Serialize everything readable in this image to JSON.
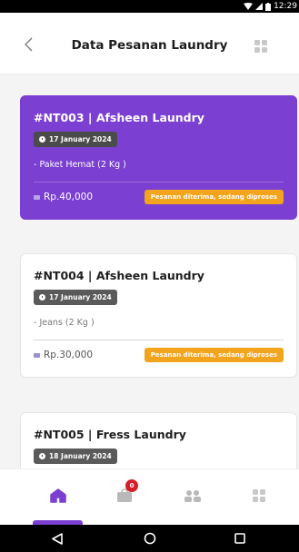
{
  "status_bar": {
    "time": "12:29"
  },
  "header": {
    "title": "Data Pesanan Laundry"
  },
  "orders": [
    {
      "title": "#NT003 | Afsheen Laundry",
      "date": "17 January 2024",
      "item": "- Paket Hemat (2 Kg )",
      "price": "Rp.40,000",
      "status": "Pesanan diterima, sedang diproses"
    },
    {
      "title": "#NT004 | Afsheen Laundry",
      "date": "17 January 2024",
      "item": "- Jeans (2 Kg )",
      "price": "Rp.30,000",
      "status": "Pesanan diterima, sedang diproses"
    },
    {
      "title": "#NT005 | Fress Laundry",
      "date": "18 January 2024"
    }
  ],
  "bottom_nav": {
    "cart_badge": "0"
  },
  "colors": {
    "accent": "#7b3fd1",
    "status_badge": "#f2a41c",
    "notif_badge": "#d61e28"
  },
  "icons": [
    "back-icon",
    "grid-icon",
    "home-icon",
    "basket-icon",
    "people-icon",
    "apps-icon",
    "clock-icon",
    "cash-icon"
  ]
}
